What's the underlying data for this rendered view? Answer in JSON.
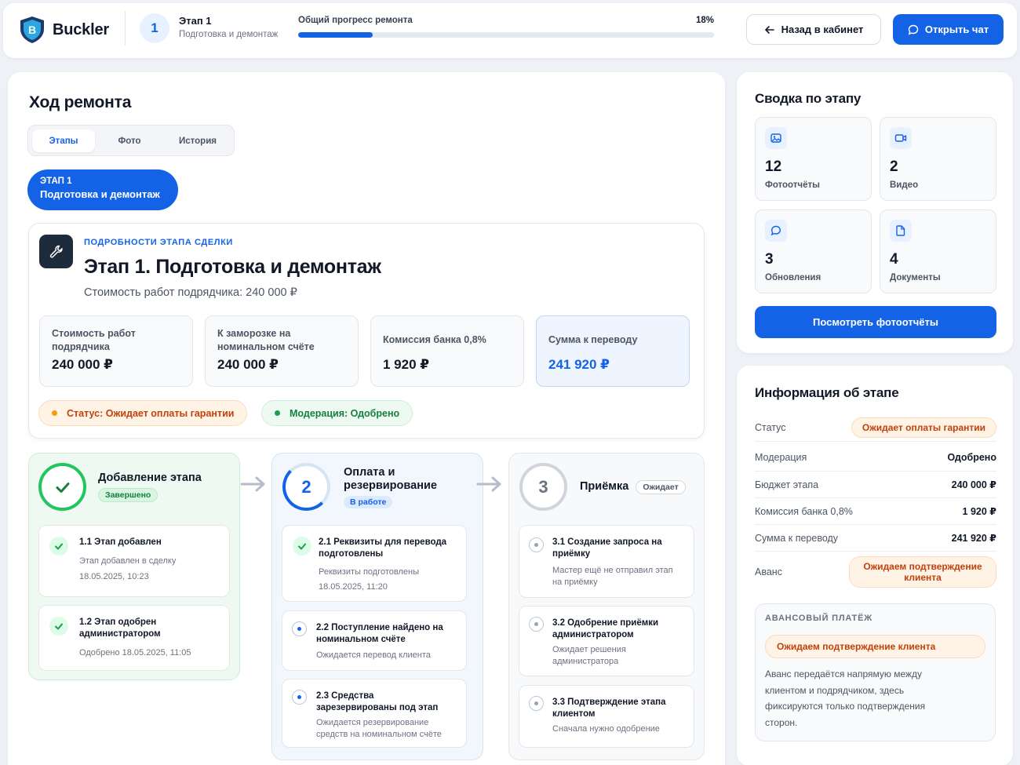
{
  "header": {
    "brand": "Buckler",
    "stage_number": "1",
    "stage_title": "Этап 1",
    "stage_subtitle": "Подготовка и демонтаж",
    "progress_label": "Общий прогресс ремонта",
    "progress_text": "18%",
    "progress_value": 0.18,
    "back_button": "Назад в кабинет",
    "chat_button": "Открыть чат"
  },
  "main": {
    "title": "Ход ремонта",
    "tabs": [
      {
        "label": "Этапы",
        "active": true
      },
      {
        "label": "Фото",
        "active": false
      },
      {
        "label": "История",
        "active": false
      }
    ],
    "stage_pill": {
      "line1": "ЭТАП 1",
      "line2": "Подготовка и демонтаж"
    },
    "details": {
      "label": "ПОДРОБНОСТИ ЭТАПА СДЕЛКИ",
      "title": "Этап 1. Подготовка и демонтаж",
      "subtitle": "Стоимость работ подрядчика: 240 000 ₽",
      "metrics": [
        {
          "label": "Стоимость работ подрядчика",
          "value": "240 000 ₽"
        },
        {
          "label": "К заморозке на номинальном счёте",
          "value": "240 000 ₽"
        },
        {
          "label": "Комиссия банка 0,8%",
          "value": "1 920 ₽"
        },
        {
          "label": "Сумма к переводу",
          "value": "241 920 ₽"
        }
      ],
      "status_badge": "Статус: Ожидает оплаты гарантии",
      "moderation_badge": "Модерация: Одобрено"
    },
    "columns": [
      {
        "number": "",
        "title": "Добавление этапа",
        "chip": "Завершено",
        "items": [
          {
            "title": "1.1 Этап добавлен",
            "desc": "Этап добавлен в сделку",
            "date": "18.05.2025, 10:23"
          },
          {
            "title": "1.2 Этап одобрен администратором",
            "desc": "Одобрено 18.05.2025, 11:05",
            "date": ""
          }
        ]
      },
      {
        "number": "2",
        "title": "Оплата и резервирование",
        "chip": "В работе",
        "items": [
          {
            "title": "2.1 Реквизиты для перевода подготовлены",
            "desc": "Реквизиты подготовлены",
            "date": "18.05.2025, 11:20"
          },
          {
            "title": "2.2 Поступление найдено на номинальном счёте",
            "desc": "Ожидается перевод клиента",
            "date": ""
          },
          {
            "title": "2.3 Средства зарезервированы под этап",
            "desc": "Ожидается резервирование средств на номинальном счёте",
            "date": ""
          }
        ]
      },
      {
        "number": "3",
        "title": "Приёмка",
        "chip": "Ожидает",
        "items": [
          {
            "title": "3.1 Создание запроса на приёмку",
            "desc": "Мастер ещё не отправил этап на приёмку",
            "date": ""
          },
          {
            "title": "3.2 Одобрение приёмки администратором",
            "desc": "Ожидает решения администратора",
            "date": ""
          },
          {
            "title": "3.3 Подтверждение этапа клиентом",
            "desc": "Сначала нужно одобрение",
            "date": ""
          }
        ]
      }
    ]
  },
  "summary": {
    "title": "Сводка по этапу",
    "cards": [
      {
        "value": "12",
        "label": "Фотоотчёты",
        "icon": "image-icon"
      },
      {
        "value": "2",
        "label": "Видео",
        "icon": "video-icon"
      },
      {
        "value": "3",
        "label": "Обновления",
        "icon": "chat-icon"
      },
      {
        "value": "4",
        "label": "Документы",
        "icon": "document-icon"
      }
    ],
    "button": "Посмотреть фотоотчёты"
  },
  "info": {
    "title": "Информация об этапе",
    "rows": [
      {
        "key": "Статус",
        "value": "Ожидает оплаты гарантии"
      },
      {
        "key": "Модерация",
        "value": "Одобрено"
      },
      {
        "key": "Бюджет этапа",
        "value": "240 000 ₽"
      },
      {
        "key": "Комиссия банка 0,8%",
        "value": "1 920 ₽"
      },
      {
        "key": "Сумма к переводу",
        "value": "241 920 ₽"
      },
      {
        "key": "Аванс",
        "value": "Ожидаем подтверждение клиента"
      }
    ],
    "advance": {
      "label": "АВАНСОВЫЙ ПЛАТЁЖ",
      "badge": "Ожидаем подтверждение клиента",
      "text": "Аванс передаётся напрямую между клиентом и подрядчиком, здесь фиксируются только подтверждения сторон."
    }
  },
  "colors": {
    "accent": "#1463e6",
    "success": "#22c55e",
    "warning": "#c2410c"
  }
}
